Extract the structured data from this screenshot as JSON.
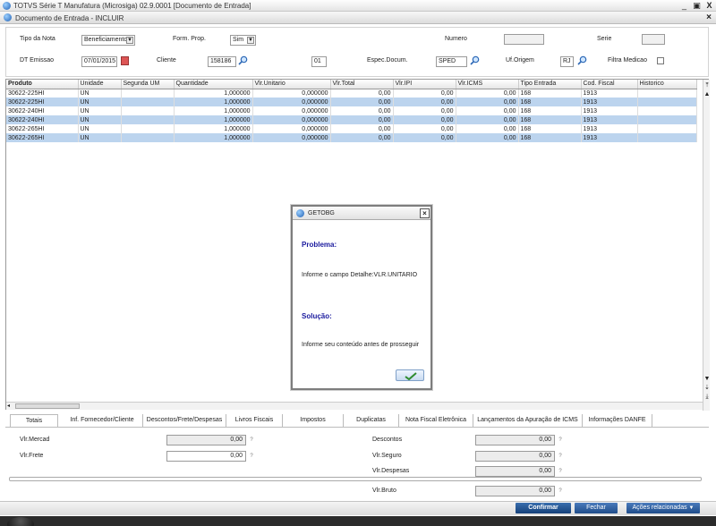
{
  "window": {
    "title": "TOTVS Série T Manufatura (Microsiga) 02.9.0001 [Documento de Entrada]",
    "subtitle": "Documento de Entrada - INCLUIR",
    "minimize": "_",
    "restore": "▣",
    "close": "X",
    "sub_close": "×"
  },
  "header": {
    "tipo_nota_label": "Tipo da Nota",
    "tipo_nota_value": "Beneficiamento",
    "form_prop_label": "Form. Prop.",
    "form_prop_value": "Sim",
    "numero_label": "Numero",
    "numero_value": "",
    "serie_label": "Serie",
    "serie_value": "",
    "dt_emissao_label": "DT Emissao",
    "dt_emissao_value": "07/01/2015",
    "cliente_label": "Cliente",
    "cliente_value": "158186",
    "loja_value": "01",
    "espec_label": "Espec.Docum.",
    "espec_value": "SPED",
    "uf_label": "Uf.Origem",
    "uf_value": "RJ",
    "filtra_label": "Filtra Medicao"
  },
  "grid": {
    "columns": [
      "Produto",
      "Unidade",
      "Segunda UM",
      "Quantidade",
      "Vlr.Unitario",
      "Vlr.Total",
      "Vlr.IPI",
      "Vlr.ICMS",
      "Tipo Entrada",
      "Cod. Fiscal",
      "Historico"
    ],
    "rows": [
      [
        "30622-225HI",
        "UN",
        "",
        "1,000000",
        "0,000000",
        "0,00",
        "0,00",
        "0,00",
        "168",
        "1913",
        ""
      ],
      [
        "30622-225HI",
        "UN",
        "",
        "1,000000",
        "0,000000",
        "0,00",
        "0,00",
        "0,00",
        "168",
        "1913",
        ""
      ],
      [
        "30622-240HI",
        "UN",
        "",
        "1,000000",
        "0,000000",
        "0,00",
        "0,00",
        "0,00",
        "168",
        "1913",
        ""
      ],
      [
        "30622-240HI",
        "UN",
        "",
        "1,000000",
        "0,000000",
        "0,00",
        "0,00",
        "0,00",
        "168",
        "1913",
        ""
      ],
      [
        "30622-265HI",
        "UN",
        "",
        "1,000000",
        "0,000000",
        "0,00",
        "0,00",
        "0,00",
        "168",
        "1913",
        ""
      ],
      [
        "30622-265HI",
        "UN",
        "",
        "1,000000",
        "0,000000",
        "0,00",
        "0,00",
        "0,00",
        "168",
        "1913",
        ""
      ]
    ]
  },
  "dialog": {
    "title": "GETOBG",
    "problema_label": "Problema:",
    "problema_text": "Informe o campo Detalhe:VLR.UNITARIO",
    "solucao_label": "Solução:",
    "solucao_text": "Informe seu conteúdo antes de prosseguir",
    "ok_icon": "checkmark-icon"
  },
  "tabs": [
    {
      "label": "Totais",
      "active": true
    },
    {
      "label": "Inf. Fornecedor/Cliente"
    },
    {
      "label": "Descontos/Frete/Despesas"
    },
    {
      "label": "Livros Fiscais"
    },
    {
      "label": "Impostos"
    },
    {
      "label": "Duplicatas"
    },
    {
      "label": "Nota Fiscal Eletrônica"
    },
    {
      "label": "Lançamentos da Apuração de ICMS"
    },
    {
      "label": "Informações DANFE"
    }
  ],
  "totais": {
    "vlr_mercad_label": "Vlr.Mercad",
    "vlr_mercad_value": "0,00",
    "vlr_frete_label": "Vlr.Frete",
    "vlr_frete_value": "0,00",
    "descontos_label": "Descontos",
    "descontos_value": "0,00",
    "vlr_seguro_label": "Vlr.Seguro",
    "vlr_seguro_value": "0,00",
    "vlr_despesas_label": "Vlr.Despesas",
    "vlr_despesas_value": "0,00",
    "vlr_bruto_label": "Vlr.Bruto",
    "vlr_bruto_value": "0,00",
    "help": "?"
  },
  "buttons": {
    "confirmar": "Confirmar",
    "fechar": "Fechar",
    "acoes": "Ações relacionadas",
    "acoes_arrow": "▼"
  },
  "colors": {
    "selected_row": "#bcd4ee",
    "primary_button": "#1f4c8a",
    "dialog_heading": "#1a1a9e"
  }
}
